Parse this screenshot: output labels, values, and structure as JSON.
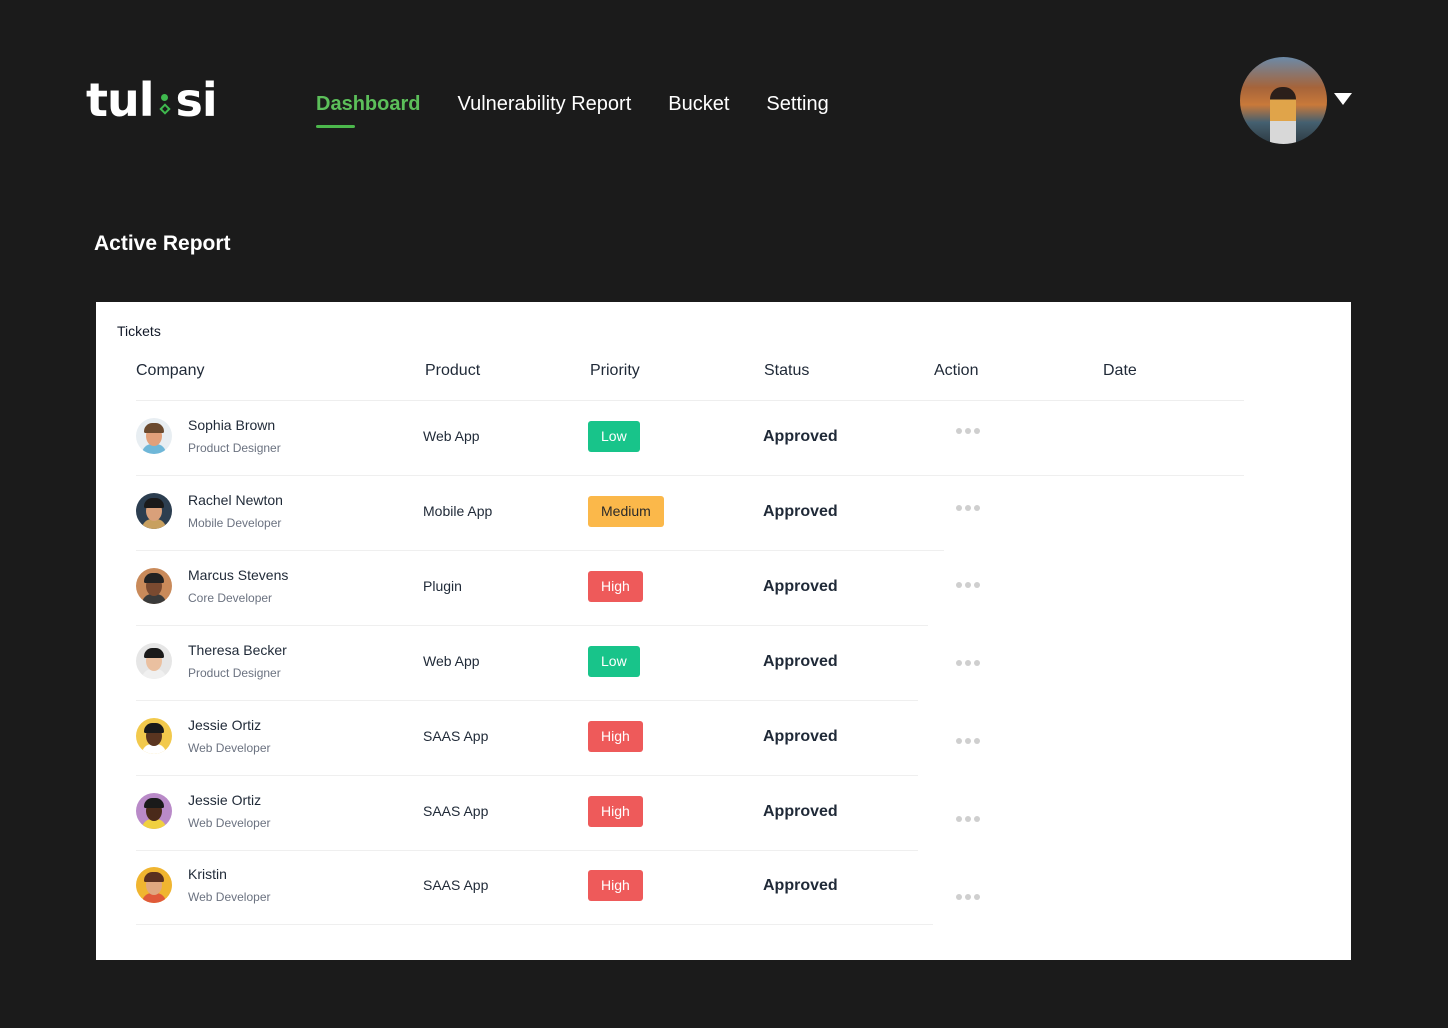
{
  "brand": {
    "logo_left": "tul",
    "logo_right": "si"
  },
  "nav": [
    {
      "label": "Dashboard",
      "active": true
    },
    {
      "label": "Vulnerability Report",
      "active": false
    },
    {
      "label": "Bucket",
      "active": false
    },
    {
      "label": "Setting",
      "active": false
    }
  ],
  "user": {
    "avatar_icon": "user-avatar",
    "menu_icon": "caret-down-icon"
  },
  "page": {
    "title": "Active Report"
  },
  "tickets": {
    "title": "Tickets",
    "columns": [
      "Company",
      "Product",
      "Priority",
      "Status",
      "Action",
      "Date"
    ],
    "rows": [
      {
        "name": "Sophia Brown",
        "role": "Product Designer",
        "product": "Web App",
        "priority": "Low",
        "status": "Approved"
      },
      {
        "name": "Rachel Newton",
        "role": "Mobile Developer",
        "product": "Mobile App",
        "priority": "Medium",
        "status": "Approved"
      },
      {
        "name": "Marcus Stevens",
        "role": "Core Developer",
        "product": "Plugin",
        "priority": "High",
        "status": "Approved"
      },
      {
        "name": "Theresa Becker",
        "role": "Product Designer",
        "product": "Web App",
        "priority": "Low",
        "status": "Approved"
      },
      {
        "name": "Jessie Ortiz",
        "role": "Web Developer",
        "product": "SAAS App",
        "priority": "High",
        "status": "Approved"
      },
      {
        "name": "Jessie Ortiz",
        "role": "Web Developer",
        "product": "SAAS App",
        "priority": "High",
        "status": "Approved"
      },
      {
        "name": "Kristin",
        "role": "Web Developer",
        "product": "SAAS App",
        "priority": "High",
        "status": "Approved"
      }
    ]
  },
  "colors": {
    "background": "#1b1b1b",
    "accent_green": "#5cbf5a",
    "priority_low": "#18c48a",
    "priority_medium": "#fbb84a",
    "priority_high": "#ee5a5a"
  }
}
